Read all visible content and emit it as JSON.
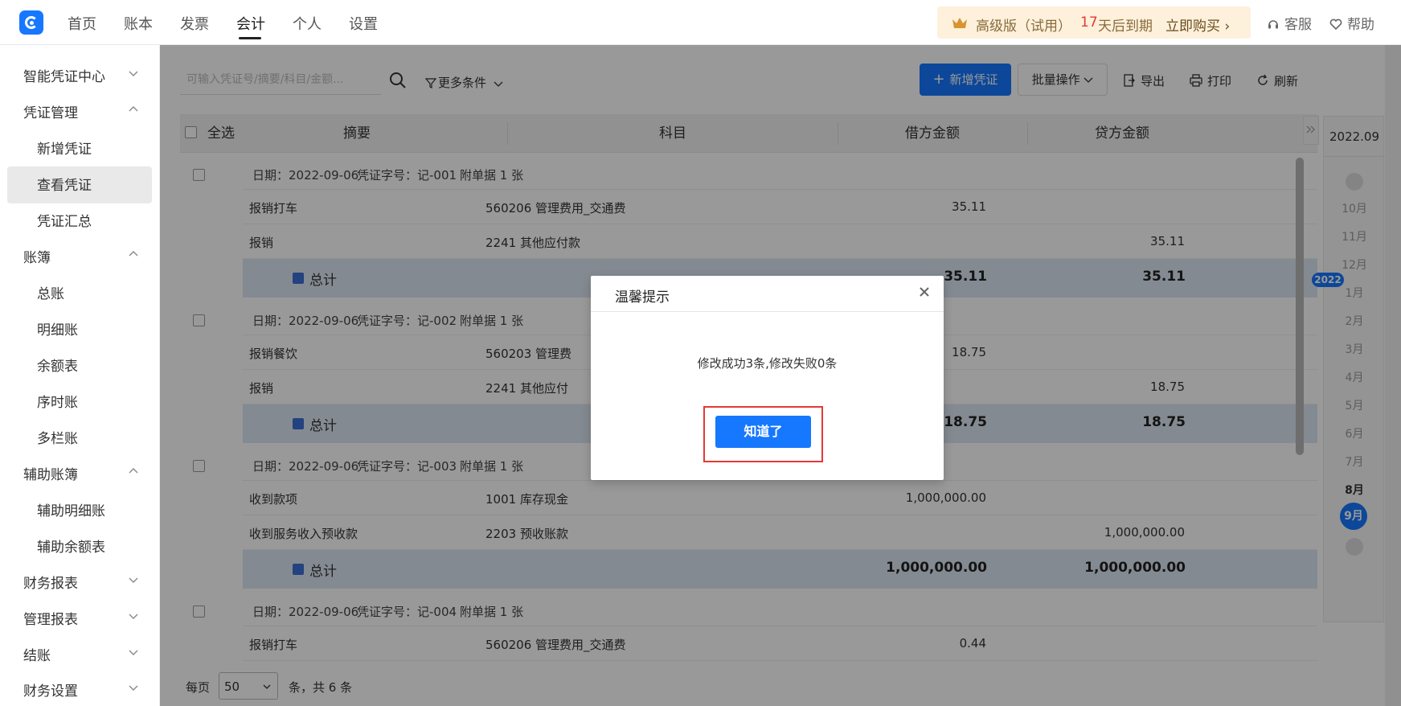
{
  "topnav": {
    "items": [
      "首页",
      "账本",
      "发票",
      "会计",
      "个人",
      "设置"
    ],
    "active": "会计",
    "promo": {
      "version": "高级版（试用）",
      "days": "17",
      "days_text": "天后到期",
      "buy": "立即购买"
    },
    "service": "客服",
    "help": "帮助"
  },
  "sidebar": {
    "items": [
      {
        "label": "智能凭证中心",
        "type": "group",
        "expanded": false
      },
      {
        "label": "凭证管理",
        "type": "group",
        "expanded": true
      },
      {
        "label": "新增凭证",
        "type": "sub"
      },
      {
        "label": "查看凭证",
        "type": "sub",
        "selected": true
      },
      {
        "label": "凭证汇总",
        "type": "sub"
      },
      {
        "label": "账簿",
        "type": "group",
        "expanded": true
      },
      {
        "label": "总账",
        "type": "sub"
      },
      {
        "label": "明细账",
        "type": "sub"
      },
      {
        "label": "余额表",
        "type": "sub"
      },
      {
        "label": "序时账",
        "type": "sub"
      },
      {
        "label": "多栏账",
        "type": "sub"
      },
      {
        "label": "辅助账簿",
        "type": "group",
        "expanded": true
      },
      {
        "label": "辅助明细账",
        "type": "sub"
      },
      {
        "label": "辅助余额表",
        "type": "sub"
      },
      {
        "label": "财务报表",
        "type": "group",
        "expanded": false
      },
      {
        "label": "管理报表",
        "type": "group",
        "expanded": false
      },
      {
        "label": "结账",
        "type": "group",
        "expanded": false
      },
      {
        "label": "财务设置",
        "type": "group",
        "expanded": false
      }
    ]
  },
  "toolbar": {
    "search_placeholder": "可输入凭证号/摘要/科目/金额...",
    "more_conditions": "更多条件",
    "add_voucher": "新增凭证",
    "batch_ops": "批量操作",
    "export": "导出",
    "print": "打印",
    "refresh": "刷新"
  },
  "table": {
    "headers": [
      "全选",
      "摘要",
      "科目",
      "借方金额",
      "贷方金额"
    ],
    "vouchers": [
      {
        "date_label": "日期：2022-09-06",
        "number_label": "凭证字号：记-001",
        "attach_label": "附单据 1 张",
        "rows": [
          {
            "summary": "报销打车",
            "subject": "560206 管理费用_交通费",
            "debit": "35.11",
            "credit": ""
          },
          {
            "summary": "报销",
            "subject": "2241 其他应付款",
            "debit": "",
            "credit": "35.11"
          }
        ],
        "total_label": "总计",
        "total_debit": "35.11",
        "total_credit": "35.11"
      },
      {
        "date_label": "日期：2022-09-06",
        "number_label": "凭证字号：记-002",
        "attach_label": "附单据 1 张",
        "rows": [
          {
            "summary": "报销餐饮",
            "subject": "560203 管理费",
            "debit": "18.75",
            "credit": ""
          },
          {
            "summary": "报销",
            "subject": "2241 其他应付",
            "debit": "",
            "credit": "18.75"
          }
        ],
        "total_label": "总计",
        "total_debit": "18.75",
        "total_credit": "18.75"
      },
      {
        "date_label": "日期：2022-09-06",
        "number_label": "凭证字号：记-003",
        "attach_label": "附单据 1 张",
        "rows": [
          {
            "summary": "收到款项",
            "subject": "1001 库存现金",
            "debit": "1,000,000.00",
            "credit": ""
          },
          {
            "summary": "收到服务收入预收款",
            "subject": "2203 预收账款",
            "debit": "",
            "credit": "1,000,000.00"
          }
        ],
        "total_label": "总计",
        "total_debit": "1,000,000.00",
        "total_credit": "1,000,000.00"
      },
      {
        "date_label": "日期：2022-09-06",
        "number_label": "凭证字号：记-004",
        "attach_label": "附单据 1 张",
        "rows": [
          {
            "summary": "报销打车",
            "subject": "560206 管理费用_交通费",
            "debit": "0.44",
            "credit": ""
          }
        ]
      }
    ]
  },
  "footer": {
    "per_page_label": "每页",
    "page_size": "50",
    "total_text": "条，共 6 条"
  },
  "timeline": {
    "period": "2022.09",
    "year": "2022",
    "months": [
      "10月",
      "11月",
      "12月",
      "1月",
      "2月",
      "3月",
      "4月",
      "5月",
      "6月",
      "7月",
      "8月"
    ],
    "current_month": "8月",
    "active_month": "9月"
  },
  "modal": {
    "title": "温馨提示",
    "message": "修改成功3条,修改失败0条",
    "ok": "知道了"
  },
  "colors": {
    "primary": "#1677ff",
    "highlight": "#e53935",
    "promo_bg": "#fdf1dc",
    "total_row_bg": "#dde6f2"
  }
}
